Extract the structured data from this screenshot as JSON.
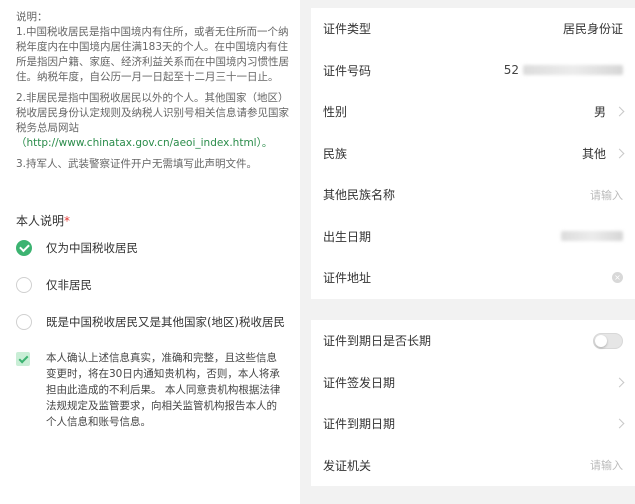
{
  "explanation": {
    "heading": "说明：",
    "item1": "1.中国税收居民是指中国境内有住所，或者无住所而一个纳税年度内在中国境内居住满183天的个人。在中国境内有住所是指因户籍、家庭、经济利益关系而在中国境内习惯性居住。纳税年度，自公历一月一日起至十二月三十一日止。",
    "item2": "2.非居民是指中国税收居民以外的个人。其他国家（地区）税收居民身份认定规则及纳税人识别号相关信息请参见国家税务总局网站",
    "item2_link": "（http://www.chinatax.gov.cn/aeoi_index.html）。",
    "item3": "3.持军人、武装警察证件开户无需填写此声明文件。"
  },
  "declaration": {
    "title": "本人说明",
    "required_mark": "*",
    "options": [
      {
        "label": "仅为中国税收居民",
        "checked": true
      },
      {
        "label": "仅非居民",
        "checked": false
      },
      {
        "label": "既是中国税收居民又是其他国家(地区)税收居民",
        "checked": false
      }
    ],
    "confirm_text": "本人确认上述信息真实，准确和完整，且这些信息变更时，将在30日内通知贵机构，否则，本人将承担由此造成的不利后果。 本人同意贵机构根据法律法规规定及监管要求，向相关监管机构报告本人的个人信息和账号信息。",
    "confirm_checked": true
  },
  "form": {
    "id_type": {
      "label": "证件类型",
      "value": "居民身份证"
    },
    "id_number": {
      "label": "证件号码",
      "value_prefix": "52"
    },
    "gender": {
      "label": "性别",
      "value": "男"
    },
    "ethnicity": {
      "label": "民族",
      "value": "其他"
    },
    "other_ethnicity": {
      "label": "其他民族名称",
      "placeholder": "请输入"
    },
    "birth_date": {
      "label": "出生日期"
    },
    "id_address": {
      "label": "证件地址"
    },
    "long_term": {
      "label": "证件到期日是否长期",
      "on": false
    },
    "issue_date": {
      "label": "证件签发日期"
    },
    "expiry_date": {
      "label": "证件到期日期"
    },
    "issuer": {
      "label": "发证机关",
      "placeholder": "请输入"
    }
  },
  "colors": {
    "accent": "#3cb371",
    "required": "#e53935",
    "link": "#2a8c4a"
  }
}
